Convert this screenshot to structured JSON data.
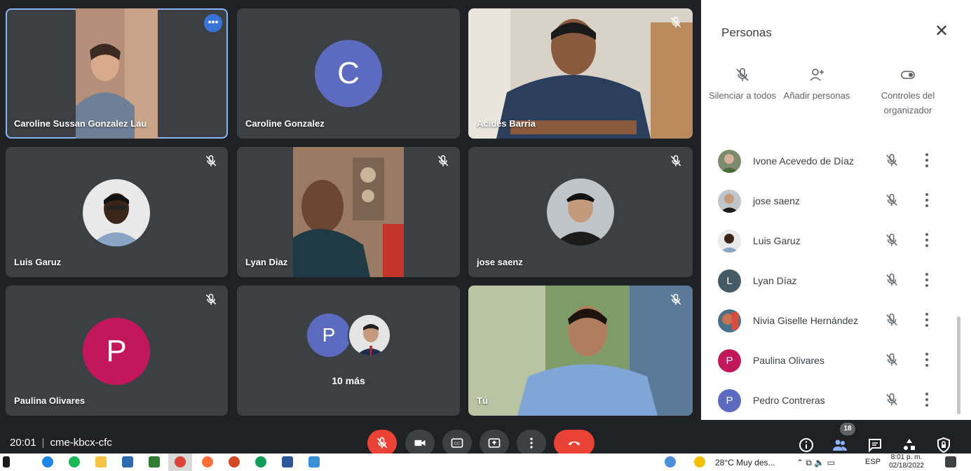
{
  "tiles": {
    "t1": {
      "name": "Caroline Sussan Gonzalez Lau"
    },
    "t2": {
      "name": "Caroline Gonzalez",
      "initial": "C"
    },
    "t3": {
      "name": "Acides Barria"
    },
    "t4": {
      "name": "Luis Garuz"
    },
    "t5": {
      "name": "Lyan Diaz"
    },
    "t6": {
      "name": "jose saenz"
    },
    "t7": {
      "name": "Paulina Olivares",
      "initial": "P"
    },
    "t8": {
      "initial": "P",
      "more": "10 más"
    },
    "t9": {
      "name": "Tú"
    }
  },
  "panel": {
    "title": "Personas",
    "actions": [
      {
        "label": "Silenciar a todos",
        "icon": "mic-off-icon"
      },
      {
        "label": "Añadir personas",
        "icon": "add-person-icon"
      },
      {
        "label": "Controles del organizador",
        "icon": "toggle-icon"
      }
    ],
    "people": [
      {
        "name": "Ivone Acevedo de Díaz"
      },
      {
        "name": "jose saenz"
      },
      {
        "name": "Luis Garuz"
      },
      {
        "name": "Lyan Díaz",
        "initial": "L"
      },
      {
        "name": "Nivia Giselle Hernández"
      },
      {
        "name": "Paulina Olivares",
        "initial": "P"
      },
      {
        "name": "Pedro Contreras",
        "initial": "P"
      }
    ]
  },
  "bottom": {
    "time": "20:01",
    "code": "cme-kbcx-cfc",
    "participant_count": "18"
  },
  "taskbar": {
    "weather": "28°C  Muy des...",
    "lang": "ESP",
    "clock_time": "8:01 p. m.",
    "clock_date": "02/18/2022"
  },
  "colors": {
    "accent_blue": "#8ab4f8",
    "end_call_red": "#ea4335",
    "avatar_c": "#5c6bc0",
    "avatar_p_pink": "#c2185b",
    "avatar_p_indigo": "#5c6bc0",
    "avatar_l": "#455a64"
  }
}
